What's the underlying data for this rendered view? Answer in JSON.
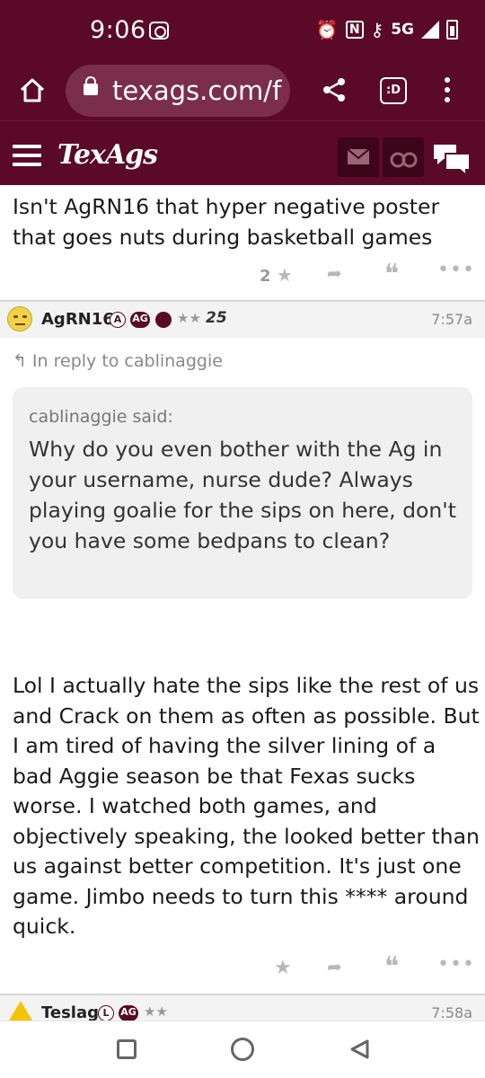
{
  "status_bar": {
    "time": "9:06",
    "network": "5G",
    "icons": [
      "record-icon",
      "alarm-icon",
      "nfc-icon",
      "key-icon",
      "data-arrows-icon",
      "signal-icon",
      "battery-icon"
    ]
  },
  "browser": {
    "url": "texags.com/f",
    "tabs_label": ":D"
  },
  "site_header": {
    "logo": "TexAgs",
    "icons": [
      "menu-icon",
      "mail-icon",
      "binoculars-icon",
      "chat-icon"
    ],
    "brand_color": "#5a0a26"
  },
  "posts": [
    {
      "body": "Isn't AgRN16 that hyper negative poster that goes nuts during basketball games",
      "star_count": "2"
    },
    {
      "username": "AgRN16",
      "badges": [
        "A",
        "AG"
      ],
      "stars": "★★",
      "years": "25",
      "time": "7:57a",
      "reply_to": "In reply to cablinaggie",
      "quote_author": "cablinaggie said:",
      "quote_text": "Why do you even bother with the Ag in your username, nurse dude? Always playing goalie for the sips on here, don't you have some bedpans to clean?",
      "body": "Lol I actually hate the sips like the rest of us and Crack on them as often as possible. But I am tired of having the silver lining of a bad Aggie season be that Fexas sucks worse. I watched both games, and objectively speaking, the looked better than us against better competition. It's just one game. Jimbo needs to turn this **** around quick."
    },
    {
      "username": "Teslag",
      "badges": [
        "L",
        "AG"
      ],
      "stars": "★★",
      "time": "7:58a"
    }
  ]
}
